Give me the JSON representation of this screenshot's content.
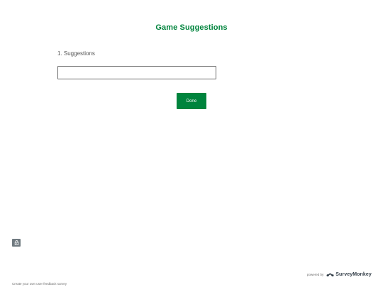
{
  "survey": {
    "title": "Game Suggestions"
  },
  "question": {
    "label": "1. Suggestions",
    "answer_value": "",
    "answer_placeholder": ""
  },
  "actions": {
    "done_label": "Done"
  },
  "footer": {
    "powered_by": "powered by",
    "brand_name": "SurveyMonkey",
    "create_link": "Create your own user feedback survey"
  },
  "icons": {
    "privacy": "lock-icon",
    "brand_logo": "surveymonkey-logo-icon"
  },
  "colors": {
    "accent": "#00843d",
    "lock_badge": "#707a80",
    "brand_text": "#333e48"
  }
}
